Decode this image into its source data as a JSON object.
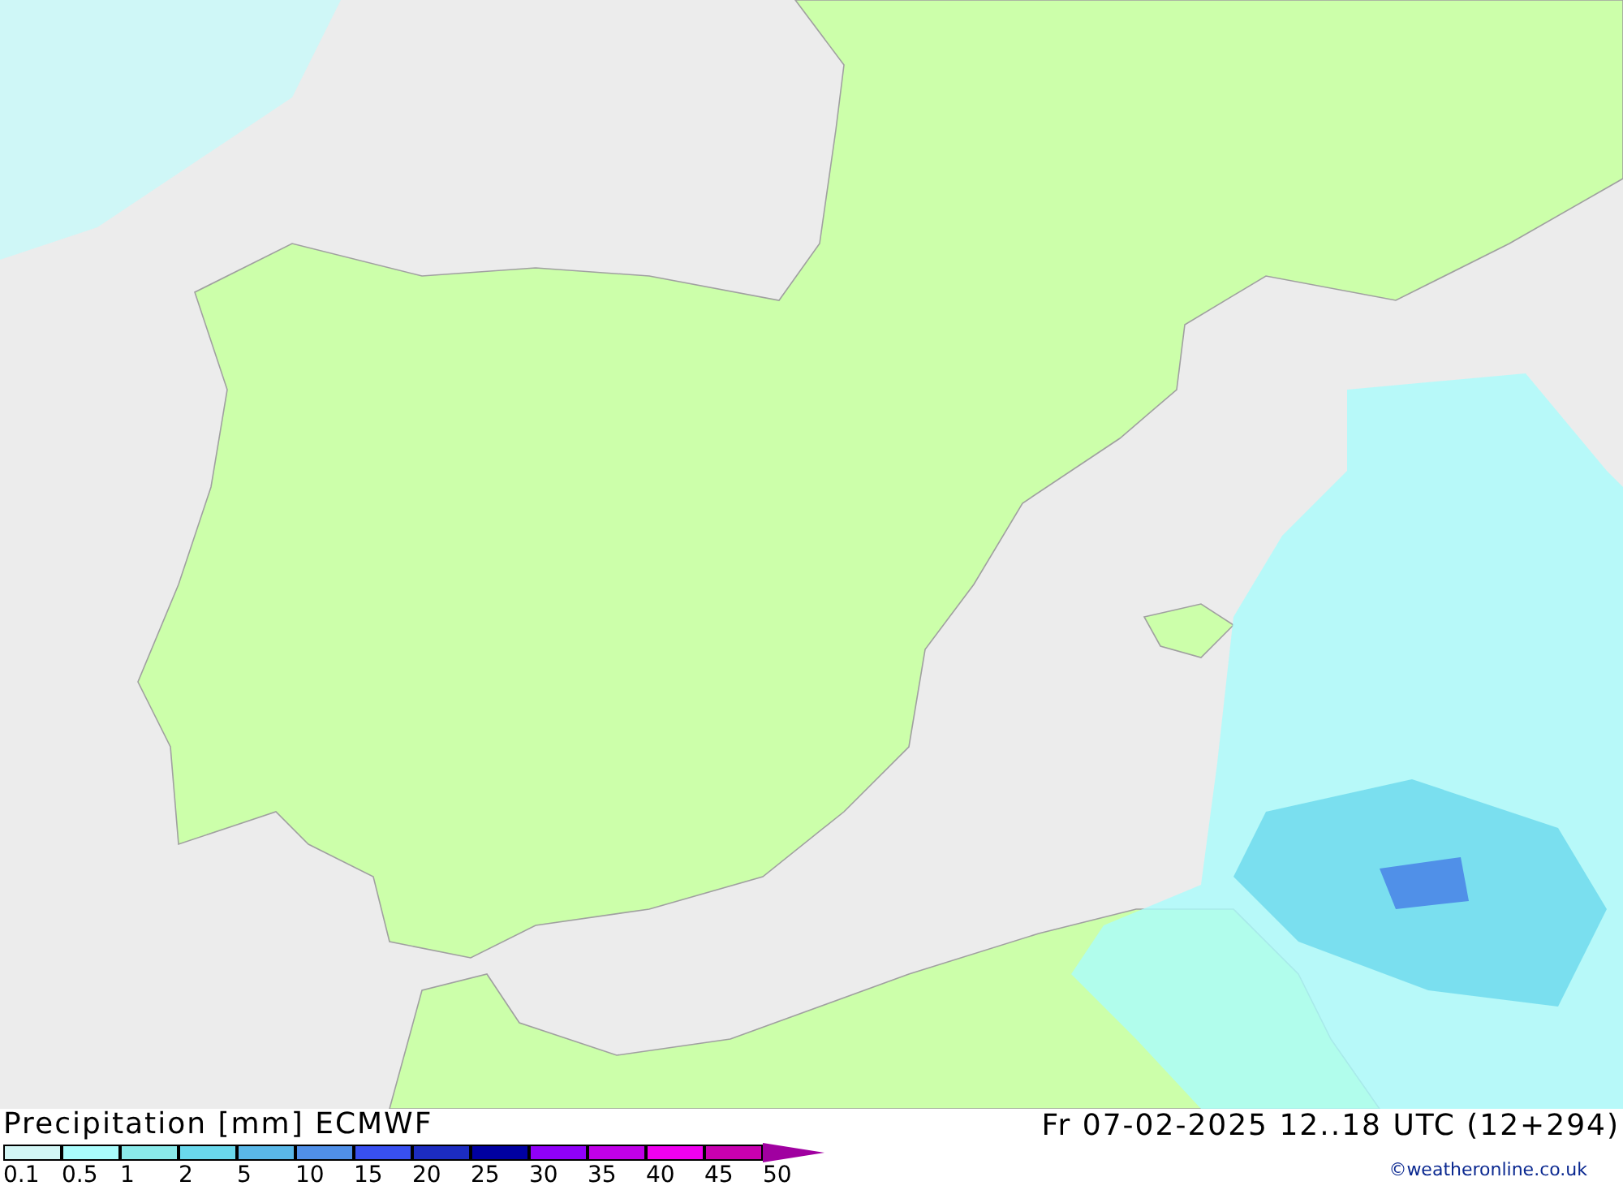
{
  "legend": {
    "title": "Precipitation [mm] ECMWF",
    "steps": [
      {
        "label": "0.1",
        "color": "#d2f6f5"
      },
      {
        "label": "0.5",
        "color": "#aafcfc"
      },
      {
        "label": "1",
        "color": "#8aeaea"
      },
      {
        "label": "2",
        "color": "#6ad8ec"
      },
      {
        "label": "5",
        "color": "#5ab8e8"
      },
      {
        "label": "10",
        "color": "#5090e8"
      },
      {
        "label": "15",
        "color": "#3850f0"
      },
      {
        "label": "20",
        "color": "#1c2cc0"
      },
      {
        "label": "25",
        "color": "#0000a0"
      },
      {
        "label": "30",
        "color": "#9000f8"
      },
      {
        "label": "35",
        "color": "#c000e8"
      },
      {
        "label": "40",
        "color": "#f000f0"
      },
      {
        "label": "45",
        "color": "#c800b0"
      },
      {
        "label": "50",
        "color": "#a000a0"
      }
    ]
  },
  "valid_time": "Fr 07-02-2025 12..18 UTC (12+294)",
  "credit": "©weatheronline.co.uk"
}
